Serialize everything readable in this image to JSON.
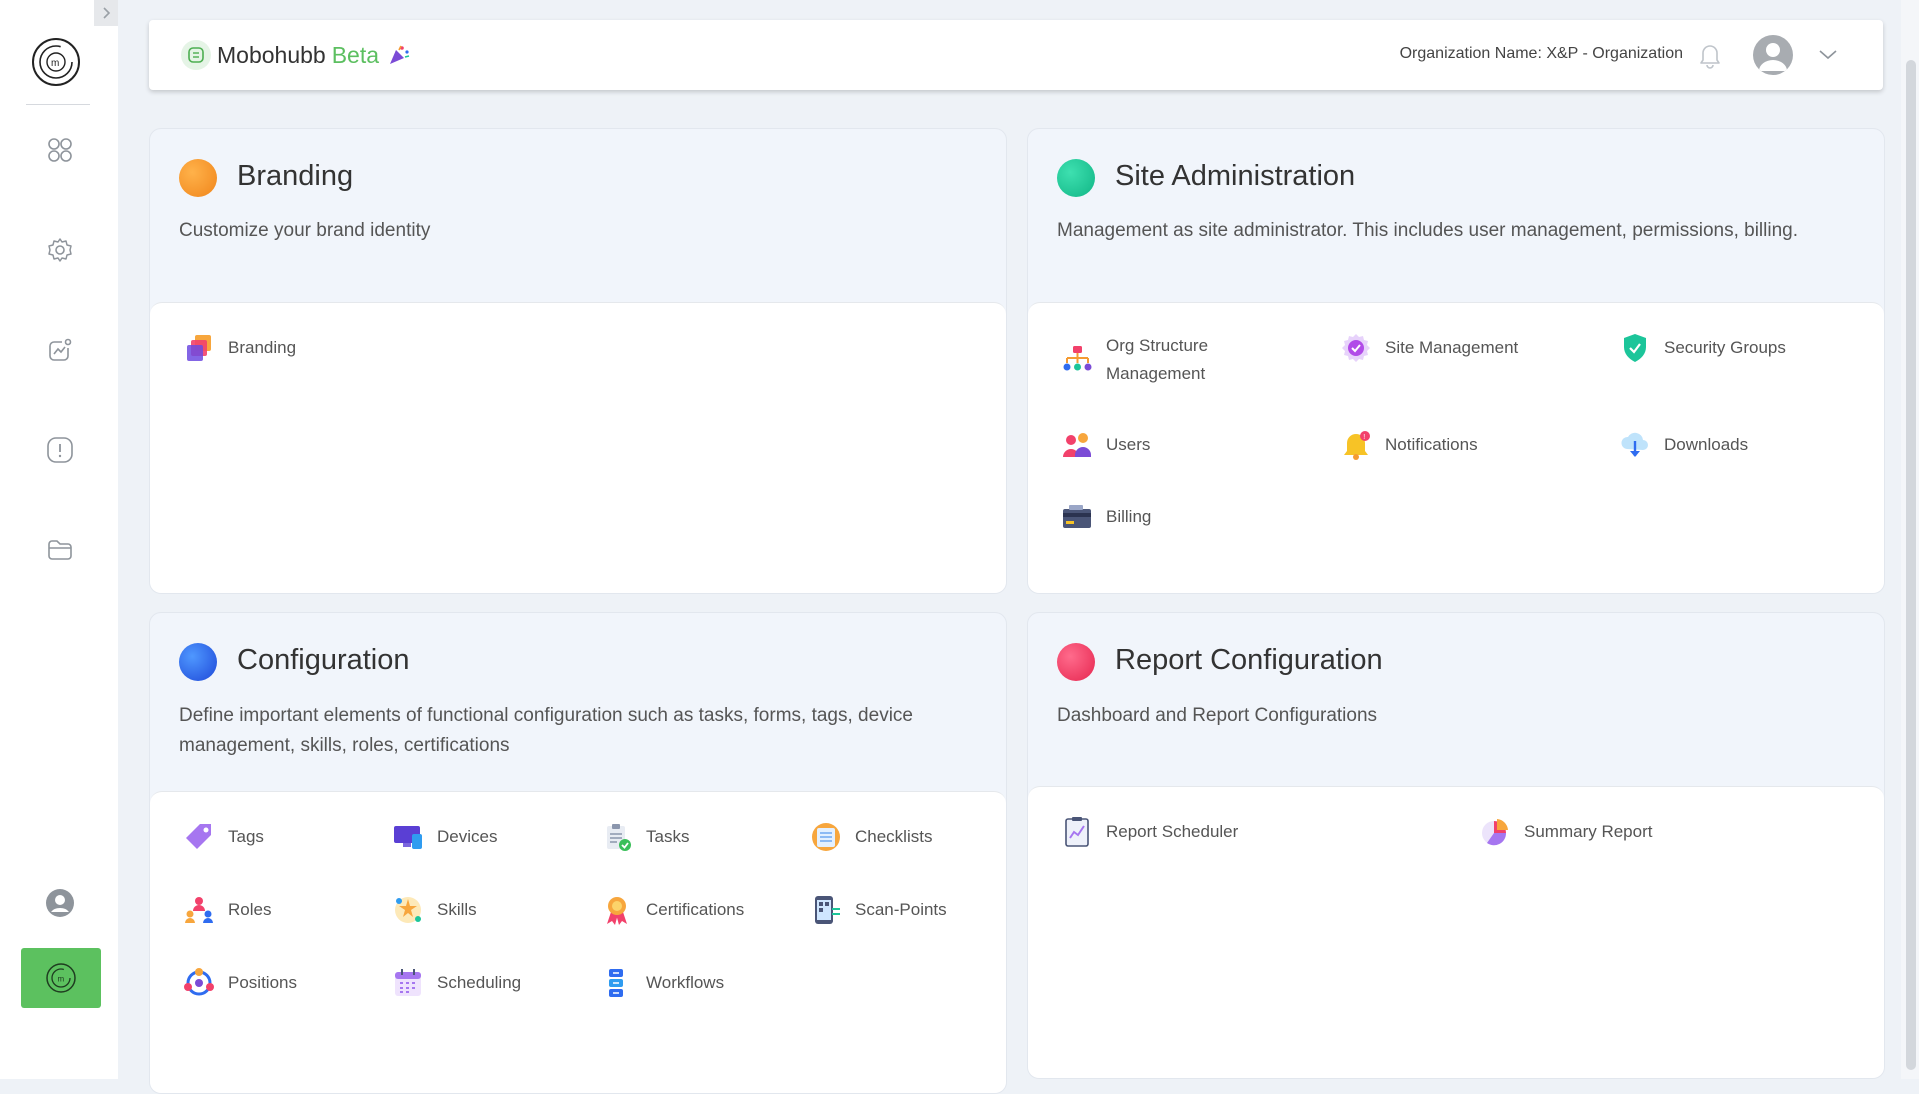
{
  "header": {
    "brand_name": "Mobohubb",
    "brand_tag": "Beta",
    "organization": "Organization Name: X&P - Organization"
  },
  "sidebar": {
    "items": [
      {
        "icon": "apps-grid-icon"
      },
      {
        "icon": "settings-gear-icon"
      },
      {
        "icon": "analytics-chart-icon"
      },
      {
        "icon": "alert-icon"
      },
      {
        "icon": "folder-icon"
      },
      {
        "icon": "user-profile-icon"
      },
      {
        "icon": "mobohubb-logo-icon",
        "active": true
      }
    ]
  },
  "cards": {
    "branding": {
      "title": "Branding",
      "description": "Customize your brand identity",
      "color": "#f49b33",
      "items": [
        {
          "label": "Branding",
          "icon": "branding-layers-icon"
        }
      ]
    },
    "site_admin": {
      "title": "Site Administration",
      "description": "Management as site administrator. This includes user management, permissions, billing.",
      "color": "#1cc59a",
      "items": [
        {
          "label_line1": "Org Structure",
          "label_line2": "Management",
          "icon": "org-structure-icon"
        },
        {
          "label": "Site Management",
          "icon": "site-management-icon"
        },
        {
          "label": "Security Groups",
          "icon": "security-shield-icon"
        },
        {
          "label": "Users",
          "icon": "users-icon"
        },
        {
          "label": "Notifications",
          "icon": "notification-bell-icon"
        },
        {
          "label": "Downloads",
          "icon": "download-cloud-icon"
        },
        {
          "label": "Billing",
          "icon": "billing-card-icon"
        }
      ]
    },
    "configuration": {
      "title": "Configuration",
      "description": "Define important elements of functional configuration such as tasks, forms, tags, device management, skills, roles, certifications",
      "color": "#2f6cf0",
      "items": [
        {
          "label": "Tags",
          "icon": "tag-icon"
        },
        {
          "label": "Devices",
          "icon": "devices-icon"
        },
        {
          "label": "Tasks",
          "icon": "tasks-clipboard-icon"
        },
        {
          "label": "Checklists",
          "icon": "checklist-icon"
        },
        {
          "label": "Roles",
          "icon": "roles-icon"
        },
        {
          "label": "Skills",
          "icon": "skills-icon"
        },
        {
          "label": "Certifications",
          "icon": "certification-ribbon-icon"
        },
        {
          "label": "Scan-Points",
          "icon": "scan-points-icon"
        },
        {
          "label": "Positions",
          "icon": "positions-icon"
        },
        {
          "label": "Scheduling",
          "icon": "calendar-icon"
        },
        {
          "label": "Workflows",
          "icon": "workflow-icon"
        }
      ]
    },
    "report_config": {
      "title": "Report Configuration",
      "description": "Dashboard and Report Configurations",
      "color": "#f2416b",
      "items": [
        {
          "label": "Report Scheduler",
          "icon": "report-scheduler-icon"
        },
        {
          "label": "Summary Report",
          "icon": "pie-chart-icon"
        }
      ]
    }
  }
}
